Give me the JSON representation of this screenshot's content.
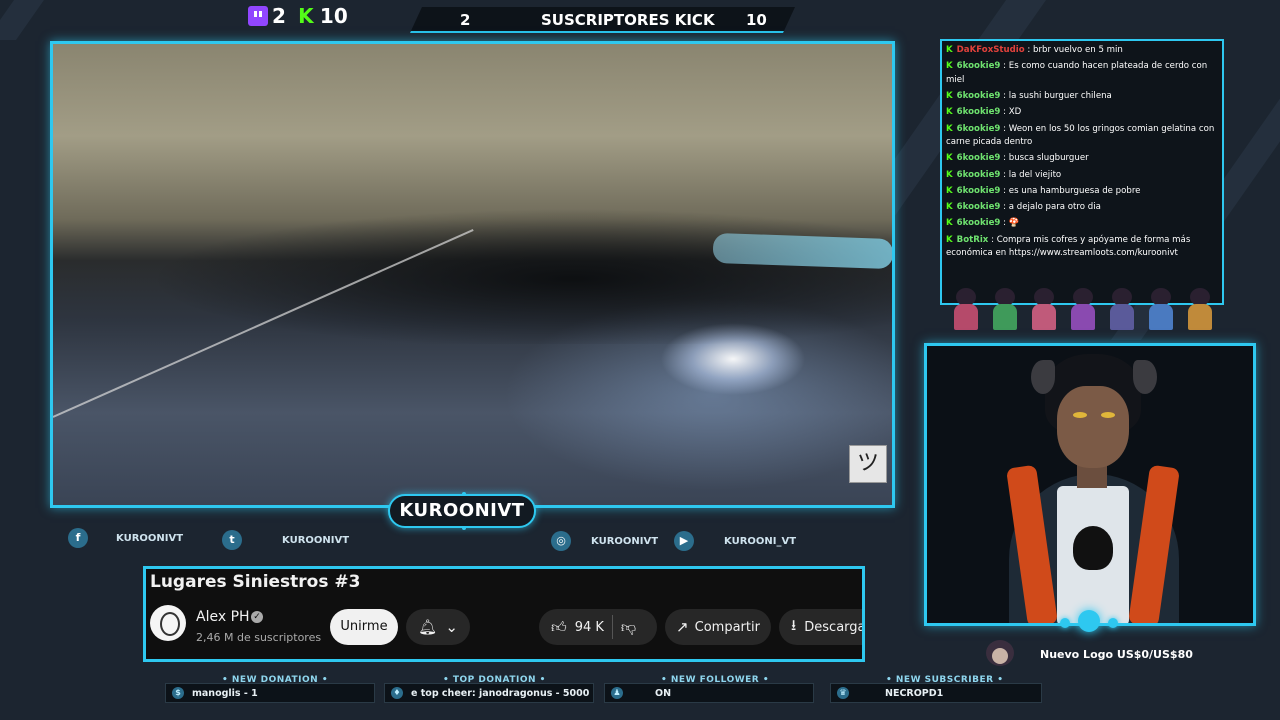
{
  "top_counts": {
    "twitch_count": "2",
    "kick_count": "10"
  },
  "top_bar": {
    "left_value": "2",
    "title": "SUSCRIPTORES KICK",
    "right_value": "10"
  },
  "channel_badge": "KUROONIVT",
  "video": {
    "watermark_glyph": "ツ"
  },
  "socials": [
    {
      "icon": "facebook-icon",
      "glyph": "f",
      "label": "KUROONIVT"
    },
    {
      "icon": "twitter-icon",
      "glyph": "t",
      "label": "KUROONIVT"
    },
    {
      "icon": "instagram-icon",
      "glyph": "◎",
      "label": "KUROONIVT"
    },
    {
      "icon": "youtube-icon",
      "glyph": "▶",
      "label": "KUROONI_VT"
    }
  ],
  "youtube": {
    "title": "Lugares Siniestros #3",
    "channel_name": "Alex PH",
    "subscribers": "2,46 M de suscriptores",
    "join_label": "Unirme",
    "likes": "94 K",
    "share_label": "Compartir",
    "download_label": "Descarga"
  },
  "chat": [
    {
      "user": "DaKFoxStudio",
      "color": "#e0413b",
      "text": "brbr vuelvo en 5 min"
    },
    {
      "user": "6kookie9",
      "color": "#6fe36f",
      "text": "Es como cuando hacen plateada de cerdo con miel"
    },
    {
      "user": "6kookie9",
      "color": "#6fe36f",
      "text": "la sushi burguer chilena"
    },
    {
      "user": "6kookie9",
      "color": "#6fe36f",
      "text": "XD"
    },
    {
      "user": "6kookie9",
      "color": "#6fe36f",
      "text": "Weon en los 50 los gringos comian gelatina con carne picada dentro"
    },
    {
      "user": "6kookie9",
      "color": "#6fe36f",
      "text": "busca slugburguer"
    },
    {
      "user": "6kookie9",
      "color": "#6fe36f",
      "text": "la del viejito"
    },
    {
      "user": "6kookie9",
      "color": "#6fe36f",
      "text": "es una hamburguesa de pobre"
    },
    {
      "user": "6kookie9",
      "color": "#6fe36f",
      "text": "a dejalo para otro dia"
    },
    {
      "user": "6kookie9",
      "color": "#6fe36f",
      "text": "🍄"
    },
    {
      "user": "BotRix",
      "color": "#6fe36f",
      "text": "Compra mis cofres y apóyame de forma más económica en https://www.streamloots.com/kuroonivt"
    }
  ],
  "sprite_colors": [
    "#b54a6a",
    "#3f9a5a",
    "#c05a7a",
    "#8a4ab0",
    "#5a5a9a",
    "#4a7ac0",
    "#c08a3a"
  ],
  "goal": {
    "text": "Nuevo Logo  US$0/US$80"
  },
  "alerts": [
    {
      "label": "• NEW DONATION •",
      "icon": "donation-icon",
      "glyph": "$",
      "value": "manoglis - 1"
    },
    {
      "label": "• TOP DONATION •",
      "icon": "top-donation-icon",
      "glyph": "♦",
      "value": "e top cheer: janodragonus - 5000"
    },
    {
      "label": "• NEW FOLLOWER •",
      "icon": "follower-icon",
      "glyph": "♟",
      "value": "ON"
    },
    {
      "label": "• NEW SUBSCRIBER •",
      "icon": "subscriber-icon",
      "glyph": "♛",
      "value": "NECROPD1"
    }
  ],
  "colors": {
    "accent": "#2ec8f0",
    "kick_green": "#53fc18",
    "twitch_purple": "#9146ff",
    "background": "#1c2530"
  }
}
